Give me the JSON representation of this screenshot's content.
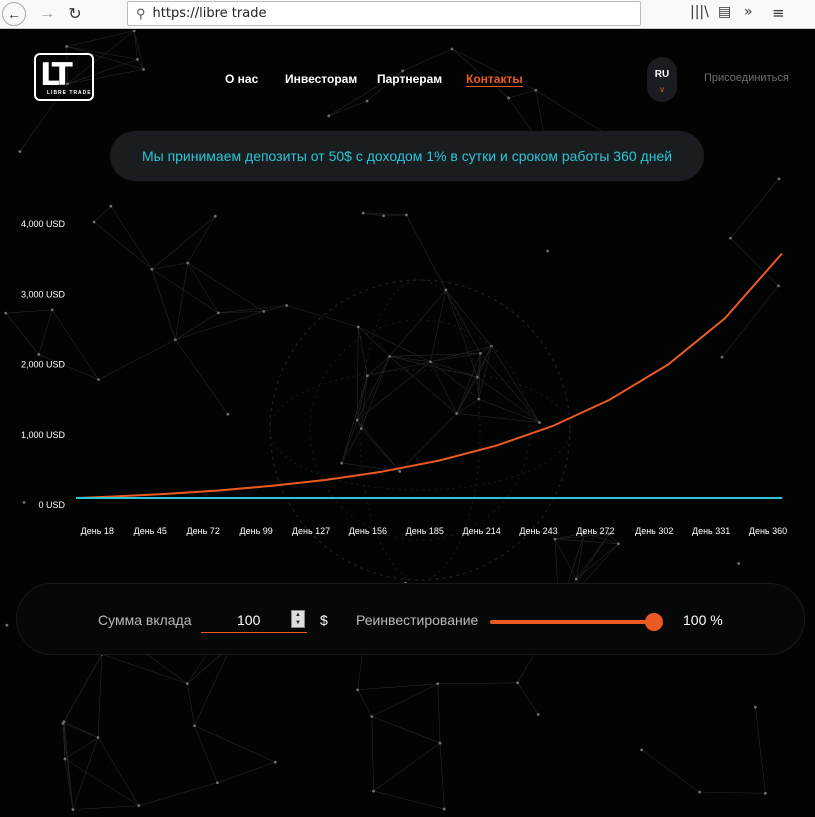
{
  "browser": {
    "back_icon": "arrow-left",
    "forward_icon": "arrow-right",
    "reload_icon": "reload",
    "url": "https://libre trade",
    "tool_icons": [
      "library-icon",
      "reader-icon",
      "overflow-chevrons-icon",
      "menu-icon"
    ]
  },
  "header": {
    "logo_mark": "LT",
    "logo_subtitle": "LIBRE TRADE",
    "nav": [
      {
        "label": "О нас",
        "active": false
      },
      {
        "label": "Инвесторам",
        "active": false
      },
      {
        "label": "Партнерам",
        "active": false
      },
      {
        "label": "Контакты",
        "active": true
      }
    ],
    "lang": "RU",
    "join": "Присоединиться"
  },
  "banner": "Мы принимаем депозиты от 50$ с доходом 1% в сутки и сроком работы 360 дней",
  "chart_data": {
    "type": "line",
    "y_ticks": [
      "4,000 USD",
      "3,000 USD",
      "2,000 USD",
      "1,000 USD",
      "0 USD"
    ],
    "ylim": [
      0,
      4000
    ],
    "x_labels": [
      "День 18",
      "День 45",
      "День 72",
      "День 99",
      "День 127",
      "День 156",
      "День 185",
      "День 214",
      "День 243",
      "День 272",
      "День 302",
      "День 331",
      "День 360"
    ],
    "series": [
      {
        "color": "#ea5a22",
        "x": [
          0,
          18,
          45,
          72,
          99,
          127,
          156,
          185,
          214,
          243,
          272,
          302,
          331,
          360
        ],
        "values": [
          100,
          120,
          157,
          205,
          270,
          356,
          474,
          632,
          842,
          1123,
          1496,
          2001,
          2660,
          3580
        ]
      },
      {
        "color": "#29c6d6",
        "x": [
          0,
          360
        ],
        "values": [
          100,
          100
        ]
      }
    ],
    "grid": false
  },
  "calculator": {
    "amount_label": "Сумма вклада",
    "amount_value": "100",
    "currency": "$",
    "reinvest_label": "Реинвестирование",
    "reinvest_percent": 100,
    "reinvest_display": "100 %"
  },
  "colors": {
    "accent": "#ea5a22",
    "cyan": "#29c6d6",
    "background": "#020303",
    "panel": "#1a1d1f"
  }
}
